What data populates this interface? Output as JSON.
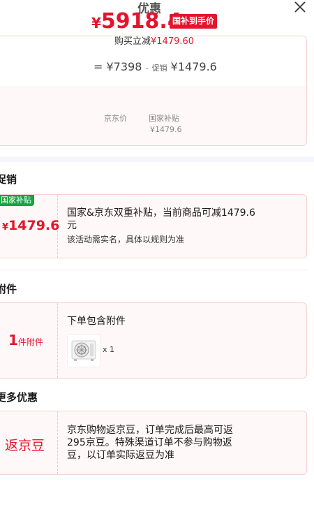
{
  "header": {
    "title": "优惠"
  },
  "price_card": {
    "currency": "¥",
    "final_price": "5918.4",
    "subsidy_tag": "国补到手价",
    "buy_reduce_label": "购买立减",
    "buy_reduce_amount": "¥1479.60",
    "formula_eq": "=",
    "jd_price": "¥7398",
    "formula_minus": "-",
    "promo_label": "促销",
    "promo_price": "¥1479.6",
    "jd_price_label": "京东价",
    "gov_subsidy_label": "国家补贴",
    "gov_subsidy_value": "¥1479.6"
  },
  "sections": {
    "promo_title": "促销",
    "accessory_title": "附件",
    "more_title": "更多优惠"
  },
  "promo": {
    "tag": "国家补贴",
    "currency": "¥",
    "amount": "1479.6",
    "desc_line1": "国家&京东双重补贴，当前商品可减1479.6",
    "desc_line2": "元",
    "note": "该活动需实名，具体以规则为准"
  },
  "accessory": {
    "count": "1",
    "count_label": "件附件",
    "desc": "下单包含附件",
    "qty": "x 1",
    "thumb_icon": "air-conditioner-outdoor-unit-icon"
  },
  "more": {
    "label": "返京豆",
    "line1": "京东购物返京豆，订单完成后最高可返",
    "line2": "295京豆。特殊渠道订单不参与购物返",
    "line3": "豆，以订单实际返豆为准"
  },
  "colors": {
    "accent": "#e4142c",
    "tag_green": "#19a33d",
    "card_bg": "#fff8f8"
  }
}
